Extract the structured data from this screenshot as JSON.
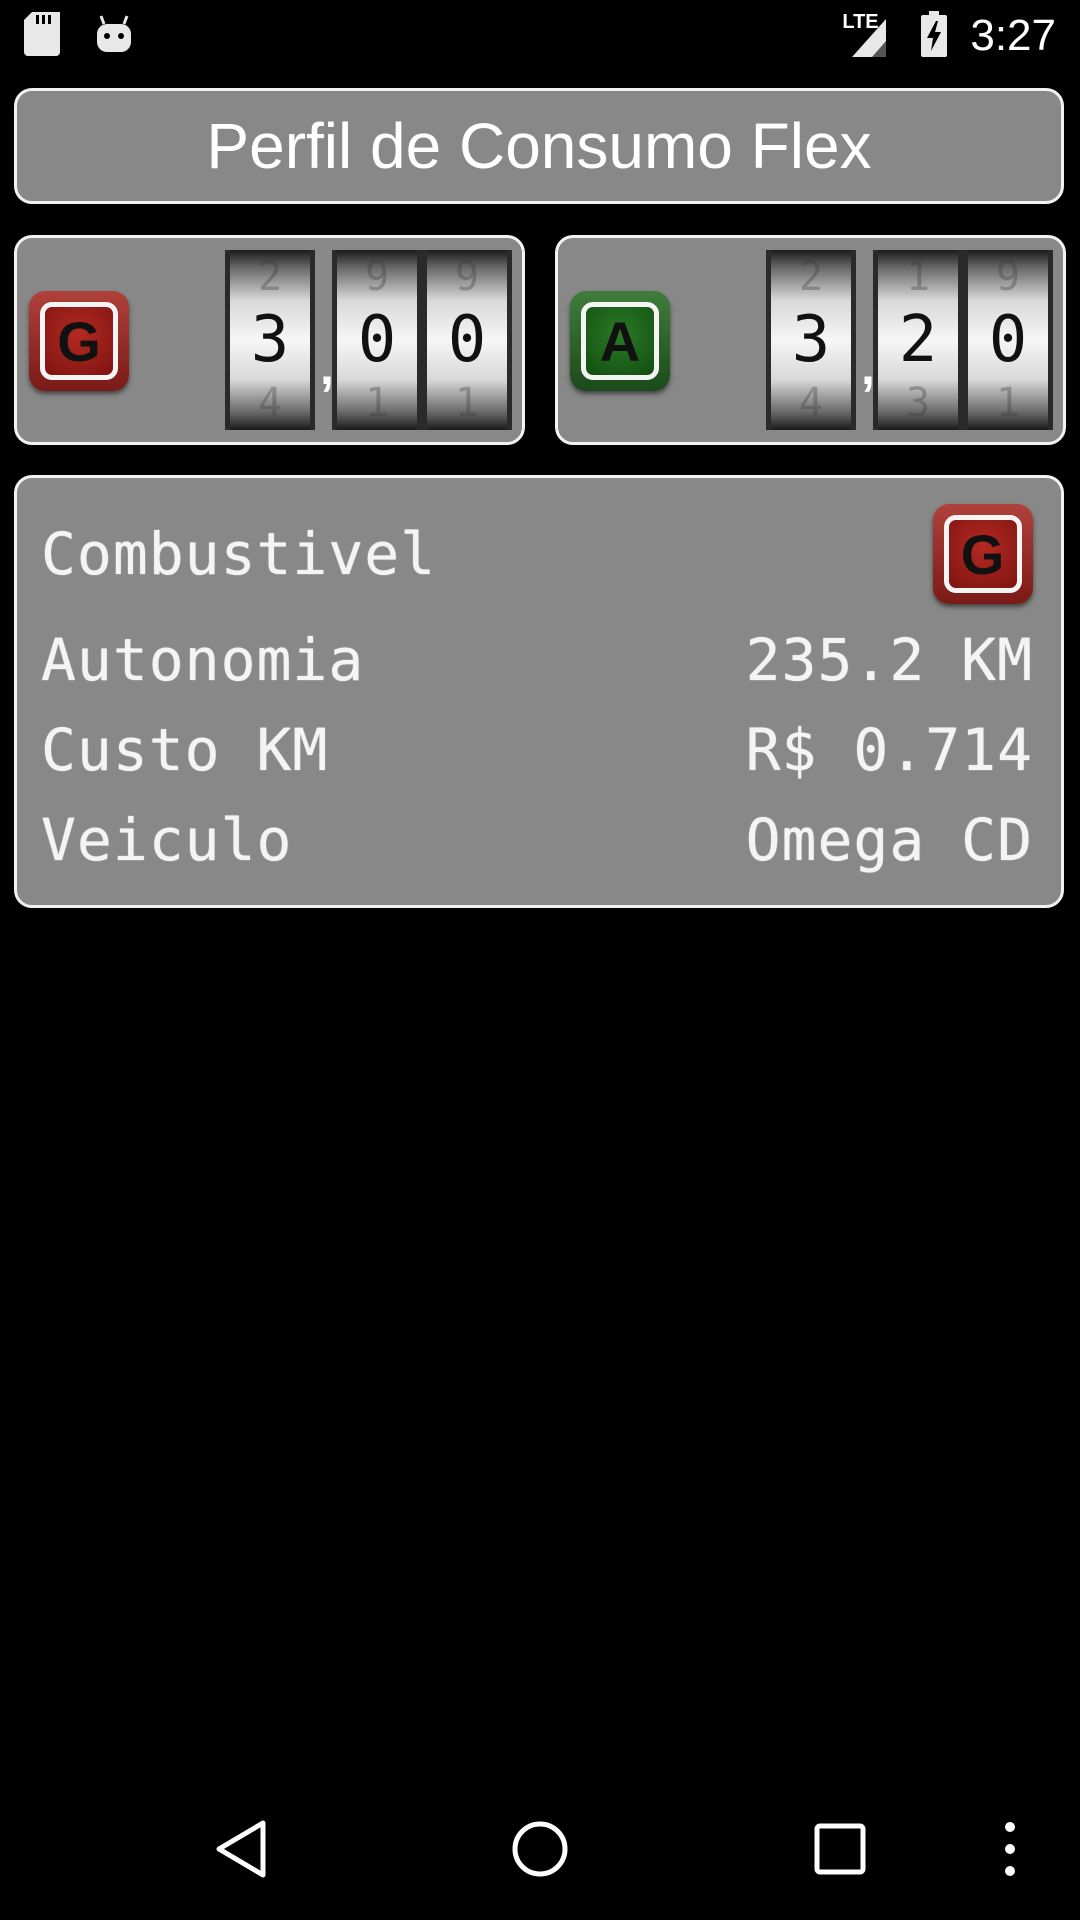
{
  "status_bar": {
    "time": "3:27",
    "network": "LTE",
    "left_icons": [
      "sd-card-icon",
      "android-icon"
    ],
    "right_icons": [
      "signal-icon",
      "battery-charging-icon"
    ]
  },
  "app": {
    "title": "Perfil de Consumo Flex"
  },
  "prices": {
    "gasoline": {
      "badge_letter": "G",
      "badge_color": "#9a2420",
      "integer_digit": "3",
      "separator": ",",
      "decimal_digits": [
        "0",
        "0"
      ]
    },
    "alcohol": {
      "badge_letter": "A",
      "badge_color": "#1f5e1c",
      "integer_digit": "3",
      "separator": ",",
      "decimal_digits": [
        "2",
        "0"
      ]
    }
  },
  "summary": {
    "fuel_label": "Combustivel",
    "fuel_badge_letter": "G",
    "autonomy_label": "Autonomia",
    "autonomy_value": "235.2 KM",
    "cost_label": "Custo KM",
    "cost_value": "R$ 0.714",
    "vehicle_label": "Veiculo",
    "vehicle_value": "Omega CD"
  },
  "nav_bar": {
    "buttons": [
      "back-icon",
      "home-icon",
      "recents-icon",
      "overflow-menu-icon"
    ]
  },
  "colors": {
    "panel_bg": "#888888",
    "panel_border": "#f2f2f2",
    "screen_bg": "#000000"
  }
}
